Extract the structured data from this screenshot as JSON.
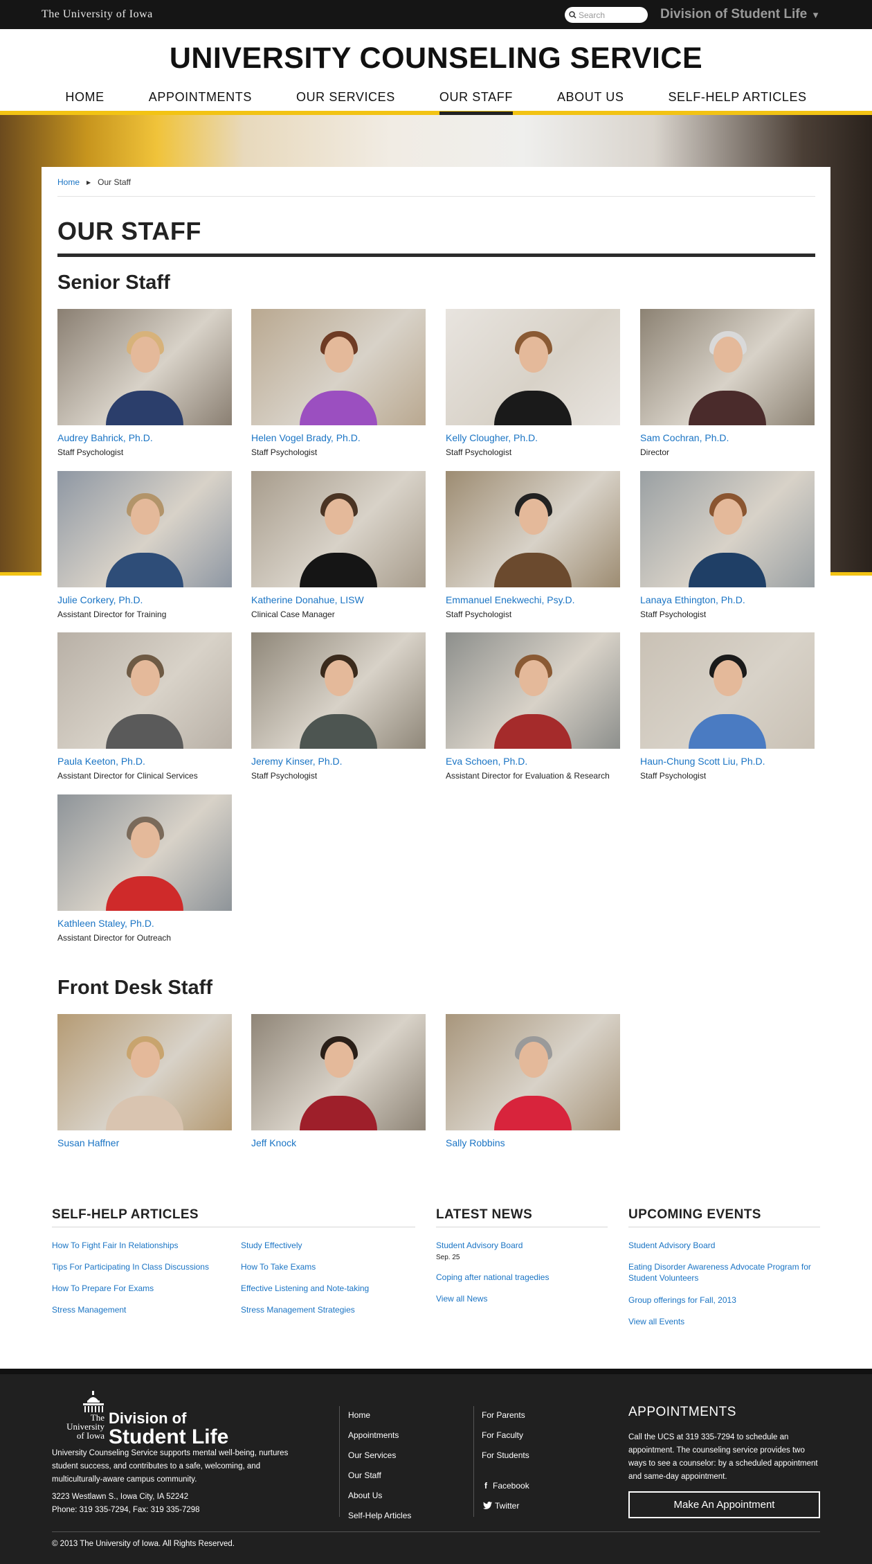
{
  "topbar": {
    "university": "The University of Iowa",
    "search_placeholder": "Search",
    "division": "Division of Student Life"
  },
  "site": {
    "title": "UNIVERSITY COUNSELING SERVICE",
    "nav": [
      "HOME",
      "APPOINTMENTS",
      "OUR SERVICES",
      "OUR STAFF",
      "ABOUT US",
      "SELF-HELP ARTICLES"
    ],
    "active_nav": "OUR STAFF"
  },
  "breadcrumb": {
    "home": "Home",
    "current": "Our Staff"
  },
  "page": {
    "title": "OUR STAFF",
    "senior_heading": "Senior Staff",
    "front_heading": "Front Desk Staff"
  },
  "senior_staff": [
    {
      "name": "Audrey Bahrick, Ph.D.",
      "role": "Staff Psychologist",
      "bg": "#8a7f72",
      "shirt": "#2b3e6b",
      "hair": "#d7b27a"
    },
    {
      "name": "Helen Vogel Brady, Ph.D.",
      "role": "Staff Psychologist",
      "bg": "#b9a890",
      "shirt": "#9b4fc0",
      "hair": "#6e3b24"
    },
    {
      "name": "Kelly Clougher, Ph.D.",
      "role": "Staff Psychologist",
      "bg": "#e8e4df",
      "shirt": "#1a1a1a",
      "hair": "#8a5a34"
    },
    {
      "name": "Sam Cochran, Ph.D.",
      "role": "Director",
      "bg": "#8c8273",
      "shirt": "#4a2b2b",
      "hair": "#d9d9d9"
    },
    {
      "name": "Julie Corkery, Ph.D.",
      "role": "Assistant Director for Training",
      "bg": "#8e97a3",
      "shirt": "#2e4d78",
      "hair": "#b2946a"
    },
    {
      "name": "Katherine Donahue, LISW",
      "role": "Clinical Case Manager",
      "bg": "#a79c8c",
      "shirt": "#151515",
      "hair": "#4a3424"
    },
    {
      "name": "Emmanuel Enekwechi, Psy.D.",
      "role": "Staff Psychologist",
      "bg": "#9d8c72",
      "shirt": "#6b4a2e",
      "hair": "#222222"
    },
    {
      "name": "Lanaya Ethington, Ph.D.",
      "role": "Staff Psychologist",
      "bg": "#9aa0a3",
      "shirt": "#1f3f66",
      "hair": "#8a5530"
    },
    {
      "name": "Paula Keeton, Ph.D.",
      "role": "Assistant Director for Clinical Services",
      "bg": "#b8b0a6",
      "shirt": "#5a5a5a",
      "hair": "#6e5a44"
    },
    {
      "name": "Jeremy Kinser, Ph.D.",
      "role": "Staff Psychologist",
      "bg": "#8f8779",
      "shirt": "#4d5551",
      "hair": "#3a2a1c"
    },
    {
      "name": "Eva Schoen, Ph.D.",
      "role": "Assistant Director for Evaluation & Research",
      "bg": "#8d8f8c",
      "shirt": "#a52b2b",
      "hair": "#8a5a34"
    },
    {
      "name": "Haun-Chung Scott Liu, Ph.D.",
      "role": "Staff Psychologist",
      "bg": "#c9c1b5",
      "shirt": "#4a7bc2",
      "hair": "#1a1a1a"
    },
    {
      "name": "Kathleen Staley, Ph.D.",
      "role": "Assistant Director for Outreach",
      "bg": "#8e9499",
      "shirt": "#cf2a2a",
      "hair": "#7a6a5a"
    }
  ],
  "front_staff": [
    {
      "name": "Susan Haffner",
      "bg": "#b59b74",
      "shirt": "#d9c4b0",
      "hair": "#c8a46e"
    },
    {
      "name": "Jeff Knock",
      "bg": "#8f8577",
      "shirt": "#9e1f2a",
      "hair": "#2a1f18"
    },
    {
      "name": "Sally Robbins",
      "bg": "#a8967c",
      "shirt": "#d8243c",
      "hair": "#9a9a9a"
    }
  ],
  "widgets": {
    "self_help": {
      "heading": "SELF-HELP ARTICLES",
      "col1": [
        "How To Fight Fair In Relationships",
        "Tips For Participating In Class Discussions",
        "How To Prepare For Exams",
        "Stress Management"
      ],
      "col2": [
        "Study Effectively",
        "How To Take Exams",
        "Effective Listening and Note-taking",
        "Stress Management Strategies"
      ]
    },
    "news": {
      "heading": "LATEST NEWS",
      "item1": "Student Advisory Board",
      "item1_date": "Sep. 25",
      "item2": "Coping after national tragedies",
      "view_all": "View all News"
    },
    "events": {
      "heading": "UPCOMING EVENTS",
      "item1": "Student Advisory Board",
      "item2": "Eating Disorder Awareness Advocate Program for Student Volunteers",
      "item3": "Group offerings for Fall, 2013",
      "view_all": "View all Events"
    }
  },
  "footer": {
    "logo_the": "The",
    "logo_univ": "University",
    "logo_of_iowa": "of Iowa",
    "logo_division": "Division of",
    "logo_student_life": "Student Life",
    "mission": "University Counseling Service supports mental well-being, nurtures student success, and contributes to a safe, welcoming, and multiculturally-aware campus community.",
    "address": "3223 Westlawn S., Iowa City, IA 52242",
    "phone": "Phone: 319 335-7294, Fax: 319 335-7298",
    "links_col1": [
      "Home",
      "Appointments",
      "Our Services",
      "Our Staff",
      "About Us",
      "Self-Help Articles"
    ],
    "links_col2": [
      "For Parents",
      "For Faculty",
      "For Students"
    ],
    "facebook": "Facebook",
    "twitter": "Twitter",
    "appt_heading": "APPOINTMENTS",
    "appt_text": "Call the UCS at 319 335-7294 to schedule an appointment. The counseling service provides two ways to see a counselor: by a scheduled appointment and same-day appointment.",
    "appt_button": "Make An Appointment",
    "copyright": "© 2013 The University of Iowa. All Rights Reserved."
  },
  "colors": {
    "gold": "#f2c314",
    "link": "#1a74c4",
    "dark": "#202020"
  }
}
